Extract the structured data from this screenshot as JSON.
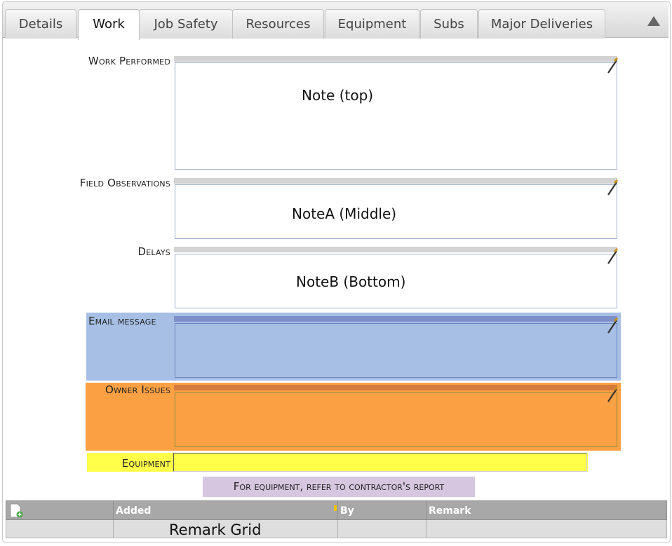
{
  "tabs": [
    {
      "label": "Details",
      "active": false
    },
    {
      "label": "Work",
      "active": true
    },
    {
      "label": "Job Safety",
      "active": false
    },
    {
      "label": "Resources",
      "active": false
    },
    {
      "label": "Equipment",
      "active": false
    },
    {
      "label": "Subs",
      "active": false
    },
    {
      "label": "Major Deliveries",
      "active": false
    }
  ],
  "fields": {
    "work_performed": {
      "label": "Work Performed",
      "note": "Note (top)"
    },
    "field_observations": {
      "label": "Field Observations",
      "note": "NoteA (Middle)"
    },
    "delays": {
      "label": "Delays",
      "note": "NoteB (Bottom)"
    },
    "email_message": {
      "label": "Email message"
    },
    "owner_issues": {
      "label": "Owner Issues"
    },
    "equipment": {
      "label": "Equipment",
      "value": ""
    }
  },
  "hint": "For equipment, refer to contractor's report",
  "grid": {
    "columns": [
      "Added",
      "By",
      "Remark"
    ],
    "caption": "Remark Grid"
  },
  "colors": {
    "email_panel": "#a7bfe4",
    "owner_panel": "#fba143",
    "equipment_panel": "#ffff4a",
    "hint_bg": "#d6c6e0"
  },
  "icons": [
    "collapse-arrow-icon",
    "edit-pencil-icon",
    "add-record-icon",
    "sort-indicator-icon"
  ]
}
